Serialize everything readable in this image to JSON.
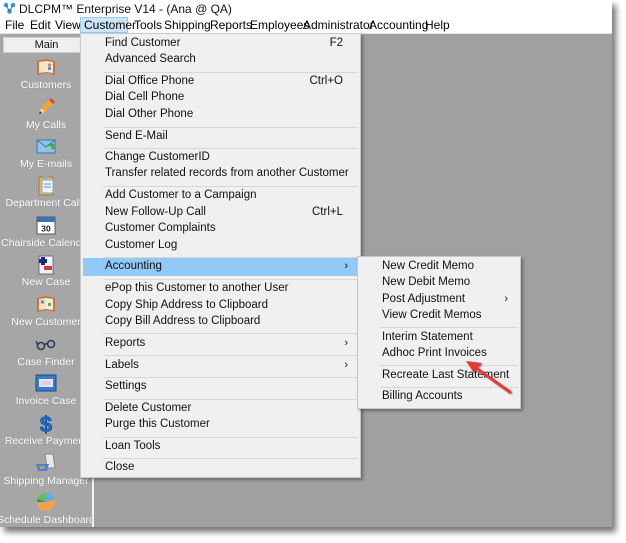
{
  "window": {
    "title": "DLCPM™ Enterprise V14 - (Ana @ QA)",
    "app_icon": "app-logo-icon"
  },
  "menubar": {
    "items": [
      {
        "label": "File"
      },
      {
        "label": "Edit"
      },
      {
        "label": "View"
      },
      {
        "label": "Customer",
        "active": true
      },
      {
        "label": "Tools"
      },
      {
        "label": "Shipping"
      },
      {
        "label": "Reports"
      },
      {
        "label": "Employees"
      },
      {
        "label": "Administrator"
      },
      {
        "label": "Accounting"
      },
      {
        "label": "Help"
      }
    ]
  },
  "sidebar": {
    "header": "Main",
    "items": [
      {
        "label": "Customers",
        "icon": "address-book-icon"
      },
      {
        "label": "My Calls",
        "icon": "pencil-icon"
      },
      {
        "label": "My E-mails",
        "icon": "envelope-icon"
      },
      {
        "label": "Department Calls",
        "icon": "clipboard-icon"
      },
      {
        "label": "Chairside Calendar",
        "icon": "calendar-icon",
        "day": "30"
      },
      {
        "label": "New Case",
        "icon": "new-case-icon"
      },
      {
        "label": "New Customer",
        "icon": "address-book-icon"
      },
      {
        "label": "Case Finder",
        "icon": "glasses-icon"
      },
      {
        "label": "Invoice Case",
        "icon": "invoice-icon"
      },
      {
        "label": "Receive Payment",
        "icon": "dollar-icon"
      },
      {
        "label": "Shipping Manager",
        "icon": "shipping-icon"
      },
      {
        "label": "Schedule Dashboard",
        "icon": "pie-chart-icon"
      }
    ]
  },
  "customer_menu": {
    "items": [
      {
        "label": "Find Customer",
        "shortcut": "F2"
      },
      {
        "label": "Advanced Search"
      },
      {
        "label": "Dial Office Phone",
        "shortcut": "Ctrl+O"
      },
      {
        "label": "Dial Cell Phone"
      },
      {
        "label": "Dial Other Phone"
      },
      {
        "label": "Send E-Mail"
      },
      {
        "label": "Change CustomerID"
      },
      {
        "label": "Transfer related records from another Customer"
      },
      {
        "label": "Add Customer to a Campaign"
      },
      {
        "label": "New Follow-Up Call",
        "shortcut": "Ctrl+L"
      },
      {
        "label": "Customer Complaints"
      },
      {
        "label": "Customer Log"
      },
      {
        "label": "Accounting",
        "submenu": true,
        "highlighted": true
      },
      {
        "label": "ePop this Customer to another User"
      },
      {
        "label": "Copy Ship Address to Clipboard"
      },
      {
        "label": "Copy Bill Address to Clipboard"
      },
      {
        "label": "Reports",
        "submenu": true
      },
      {
        "label": "Labels",
        "submenu": true
      },
      {
        "label": "Settings"
      },
      {
        "label": "Delete Customer"
      },
      {
        "label": "Purge this Customer"
      },
      {
        "label": "Loan Tools"
      },
      {
        "label": "Close"
      }
    ]
  },
  "accounting_submenu": {
    "items": [
      {
        "label": "New Credit Memo"
      },
      {
        "label": "New Debit Memo"
      },
      {
        "label": "Post Adjustment",
        "submenu": true
      },
      {
        "label": "View Credit Memos"
      },
      {
        "label": "Interim Statement"
      },
      {
        "label": "Adhoc Print Invoices",
        "annotated": true
      },
      {
        "label": "Recreate Last Statement"
      },
      {
        "label": "Billing Accounts"
      }
    ]
  },
  "annotation": {
    "arrow_color": "#e03a3a",
    "target": "Adhoc Print Invoices"
  },
  "symbols": {
    "submenu_arrow": "›"
  }
}
